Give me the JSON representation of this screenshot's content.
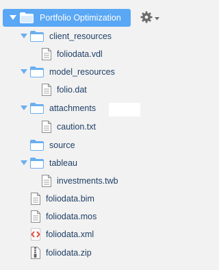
{
  "tree": {
    "root": {
      "label": "Portfolio Optimization",
      "icon": "folder-icon"
    },
    "items": [
      {
        "label": "client_resources",
        "icon": "folder-icon",
        "expanded": true
      },
      {
        "label": "foliodata.vdl",
        "icon": "file-icon"
      },
      {
        "label": "model_resources",
        "icon": "folder-icon",
        "expanded": true
      },
      {
        "label": "folio.dat",
        "icon": "file-icon"
      },
      {
        "label": "attachments",
        "icon": "folder-icon",
        "expanded": true
      },
      {
        "label": "caution.txt",
        "icon": "file-icon"
      },
      {
        "label": "source",
        "icon": "folder-icon"
      },
      {
        "label": "tableau",
        "icon": "folder-icon",
        "expanded": true
      },
      {
        "label": "investments.twb",
        "icon": "file-icon"
      },
      {
        "label": "foliodata.bim",
        "icon": "file-icon"
      },
      {
        "label": "foliodata.mos",
        "icon": "file-icon"
      },
      {
        "label": "foliodata.xml",
        "icon": "xml-file-icon"
      },
      {
        "label": "foliodata.zip",
        "icon": "zip-file-icon"
      }
    ]
  },
  "toolbar": {
    "settings_icon": "gear-icon"
  },
  "colors": {
    "selected_bg": "#59a7f5",
    "folder": "#6aaef0",
    "text": "#1f3f66",
    "background": "#f2f2f2",
    "xml_icon": "#e14b3b"
  }
}
